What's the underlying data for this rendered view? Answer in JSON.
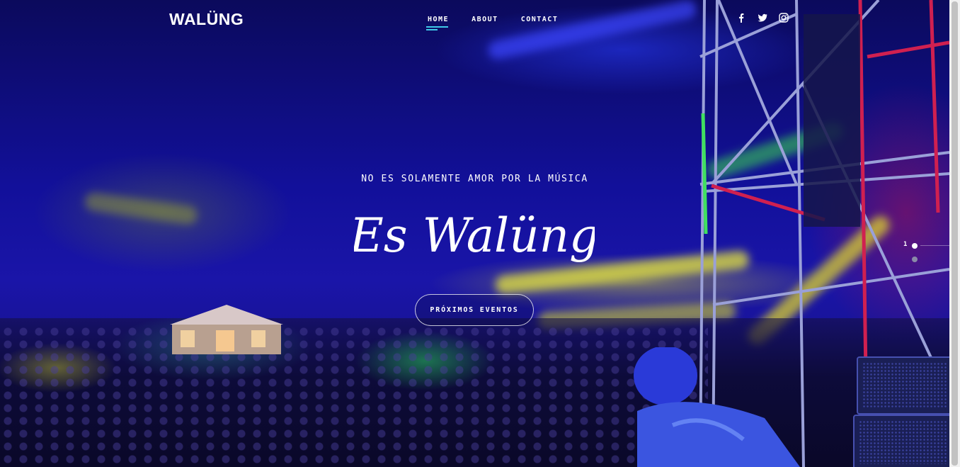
{
  "brand": {
    "logo": "WALÜNG"
  },
  "nav": {
    "items": [
      {
        "label": "HOME",
        "active": true
      },
      {
        "label": "ABOUT",
        "active": false
      },
      {
        "label": "CONTACT",
        "active": false
      }
    ],
    "accent_color": "#3ec8e8"
  },
  "social": {
    "icons": [
      "facebook-icon",
      "twitter-icon",
      "instagram-icon"
    ]
  },
  "hero": {
    "tagline": "NO ES SOLAMENTE AMOR POR LA MÚSICA",
    "headline": "Es Walüng",
    "cta_label": "PRÓXIMOS EVENTOS"
  },
  "slider": {
    "current": "1",
    "total_slides": 2,
    "active_index": 0
  }
}
